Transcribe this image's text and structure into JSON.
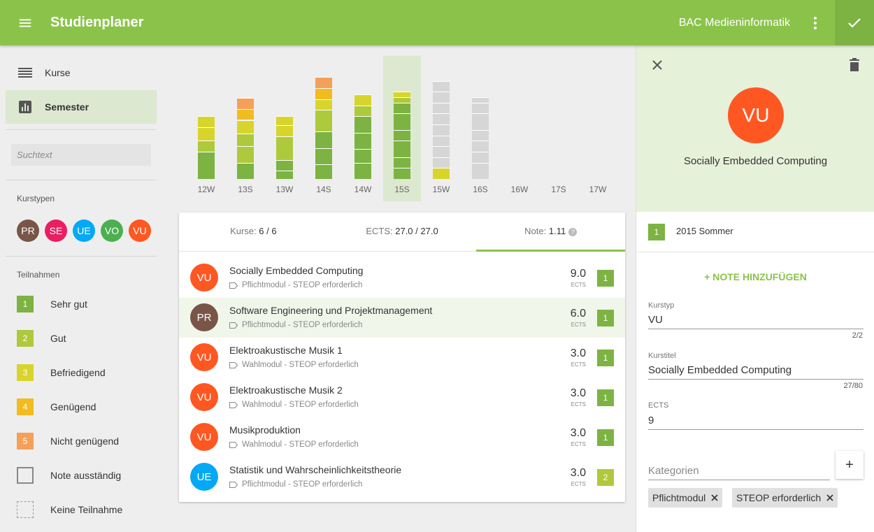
{
  "topbar": {
    "title": "Studienplaner",
    "program": "BAC Medieninformatik",
    "color": "#8bc34a"
  },
  "sidebar": {
    "nav": [
      {
        "label": "Kurse",
        "icon": "list-icon"
      },
      {
        "label": "Semester",
        "icon": "bar-chart-icon",
        "active": true
      }
    ],
    "search_placeholder": "Suchtext",
    "kurstypen_label": "Kurstypen",
    "kurstypen": [
      {
        "label": "PR",
        "color": "#795548"
      },
      {
        "label": "SE",
        "color": "#e91e63"
      },
      {
        "label": "UE",
        "color": "#03a9f4"
      },
      {
        "label": "VO",
        "color": "#4caf50"
      },
      {
        "label": "VU",
        "color": "#ff5722"
      }
    ],
    "teilnahmen_label": "Teilnahmen",
    "legend": [
      {
        "code": "1",
        "label": "Sehr gut",
        "color": "#7cb342"
      },
      {
        "code": "2",
        "label": "Gut",
        "color": "#afc93c"
      },
      {
        "code": "3",
        "label": "Befriedigend",
        "color": "#d7d52c"
      },
      {
        "code": "4",
        "label": "Genügend",
        "color": "#f2bb1f"
      },
      {
        "code": "5",
        "label": "Nicht genügend",
        "color": "#f4a058"
      },
      {
        "code": "",
        "label": "Note ausständig",
        "style": "outlined"
      },
      {
        "code": "",
        "label": "Keine Teilnahme",
        "style": "dashed"
      }
    ]
  },
  "chart_data": {
    "type": "bar",
    "stacked": true,
    "categories": [
      "12W",
      "13S",
      "13W",
      "14S",
      "14W",
      "15S",
      "15W",
      "16S",
      "16W",
      "17S",
      "17W"
    ],
    "selected": "15S",
    "unit": "ECTS",
    "bars": [
      {
        "segments": [
          {
            "value": 15,
            "grade": 1
          },
          {
            "value": 6,
            "grade": 2
          },
          {
            "value": 7.5,
            "grade": 3
          },
          {
            "value": 6,
            "grade": 3
          }
        ]
      },
      {
        "segments": [
          {
            "value": 9,
            "grade": 1
          },
          {
            "value": 9,
            "grade": 2
          },
          {
            "value": 7,
            "grade": 2
          },
          {
            "value": 7.5,
            "grade": 3
          },
          {
            "value": 6,
            "grade": 4
          },
          {
            "value": 6,
            "grade": 5
          }
        ]
      },
      {
        "segments": [
          {
            "value": 4.5,
            "grade": 1
          },
          {
            "value": 6,
            "grade": 1
          },
          {
            "value": 13,
            "grade": 2
          },
          {
            "value": 6,
            "grade": 3
          },
          {
            "value": 5,
            "grade": 3
          }
        ]
      },
      {
        "segments": [
          {
            "value": 8,
            "grade": 1
          },
          {
            "value": 9,
            "grade": 1
          },
          {
            "value": 9,
            "grade": 1
          },
          {
            "value": 12,
            "grade": 2
          },
          {
            "value": 6,
            "grade": 3
          },
          {
            "value": 6,
            "grade": 4
          },
          {
            "value": 6,
            "grade": 5
          }
        ]
      },
      {
        "segments": [
          {
            "value": 9,
            "grade": 1
          },
          {
            "value": 7.5,
            "grade": 1
          },
          {
            "value": 9,
            "grade": 1
          },
          {
            "value": 9,
            "grade": 1
          },
          {
            "value": 6,
            "grade": 2
          },
          {
            "value": 6,
            "grade": 3
          }
        ]
      },
      {
        "segments": [
          {
            "value": 6,
            "grade": 1
          },
          {
            "value": 6,
            "grade": 1
          },
          {
            "value": 9,
            "grade": 1
          },
          {
            "value": 6,
            "grade": 1
          },
          {
            "value": 9,
            "grade": 1
          },
          {
            "value": 6,
            "grade": 1
          },
          {
            "value": 3,
            "grade": 2
          },
          {
            "value": 3,
            "grade": 3
          }
        ]
      },
      {
        "segments": [
          {
            "value": 6,
            "grade": 3
          },
          {
            "value": 6,
            "grade": 0
          },
          {
            "value": 6,
            "grade": 0
          },
          {
            "value": 6,
            "grade": 0
          },
          {
            "value": 6,
            "grade": 0
          },
          {
            "value": 6,
            "grade": 0
          },
          {
            "value": 6,
            "grade": 0
          },
          {
            "value": 6,
            "grade": 0
          },
          {
            "value": 6,
            "grade": 0
          }
        ]
      },
      {
        "segments": [
          {
            "value": 9,
            "grade": 0
          },
          {
            "value": 6,
            "grade": 0
          },
          {
            "value": 6,
            "grade": 0
          },
          {
            "value": 6,
            "grade": 0
          },
          {
            "value": 9,
            "grade": 0
          },
          {
            "value": 6,
            "grade": 0
          },
          {
            "value": 3,
            "grade": 0
          }
        ]
      },
      {
        "segments": []
      },
      {
        "segments": []
      },
      {
        "segments": []
      }
    ],
    "ylim": [
      0,
      60
    ]
  },
  "summary": {
    "kurse_label": "Kurse:",
    "kurse_value": "6 / 6",
    "ects_label": "ECTS:",
    "ects_value": "27.0 / 27.0",
    "note_label": "Note:",
    "note_value": "1.11",
    "help_glyph": "?"
  },
  "courses": [
    {
      "type": "VU",
      "type_color": "#ff5722",
      "title": "Socially Embedded Computing",
      "sub": "Pflichtmodul - STEOP erforderlich",
      "ects": "9.0",
      "unit": "ECTS",
      "grade": "1",
      "grade_color": "#7cb342"
    },
    {
      "type": "PR",
      "type_color": "#795548",
      "title": "Software Engineering und Projektmanagement",
      "sub": "Pflichtmodul - STEOP erforderlich",
      "ects": "6.0",
      "unit": "ECTS",
      "grade": "1",
      "grade_color": "#7cb342",
      "selected": true
    },
    {
      "type": "VU",
      "type_color": "#ff5722",
      "title": "Elektroakustische Musik 1",
      "sub": "Wahlmodul - STEOP erforderlich",
      "ects": "3.0",
      "unit": "ECTS",
      "grade": "1",
      "grade_color": "#7cb342"
    },
    {
      "type": "VU",
      "type_color": "#ff5722",
      "title": "Elektroakustische Musik 2",
      "sub": "Wahlmodul - STEOP erforderlich",
      "ects": "3.0",
      "unit": "ECTS",
      "grade": "1",
      "grade_color": "#7cb342"
    },
    {
      "type": "VU",
      "type_color": "#ff5722",
      "title": "Musikproduktion",
      "sub": "Wahlmodul - STEOP erforderlich",
      "ects": "3.0",
      "unit": "ECTS",
      "grade": "1",
      "grade_color": "#7cb342"
    },
    {
      "type": "UE",
      "type_color": "#03a9f4",
      "title": "Statistik und Wahrscheinlichkeitstheorie",
      "sub": "Pflichtmodul - STEOP erforderlich",
      "ects": "3.0",
      "unit": "ECTS",
      "grade": "2",
      "grade_color": "#afc93c"
    }
  ],
  "detail": {
    "avatar": "VU",
    "title": "Socially Embedded Computing",
    "semester_grade": "1",
    "semester_label": "2015 Sommer",
    "add_grade": "+ NOTE HINZUFÜGEN",
    "kurstyp_label": "Kurstyp",
    "kurstyp_value": "VU",
    "kurstyp_count": "2/2",
    "kurstitel_label": "Kurstitel",
    "kurstitel_value": "Socially Embedded Computing",
    "kurstitel_count": "27/80",
    "ects_label": "ECTS",
    "ects_value": "9",
    "kategorien_placeholder": "Kategorien",
    "add_glyph": "+",
    "tags": [
      "Pflichtmodul",
      "STEOP erforderlich"
    ]
  }
}
